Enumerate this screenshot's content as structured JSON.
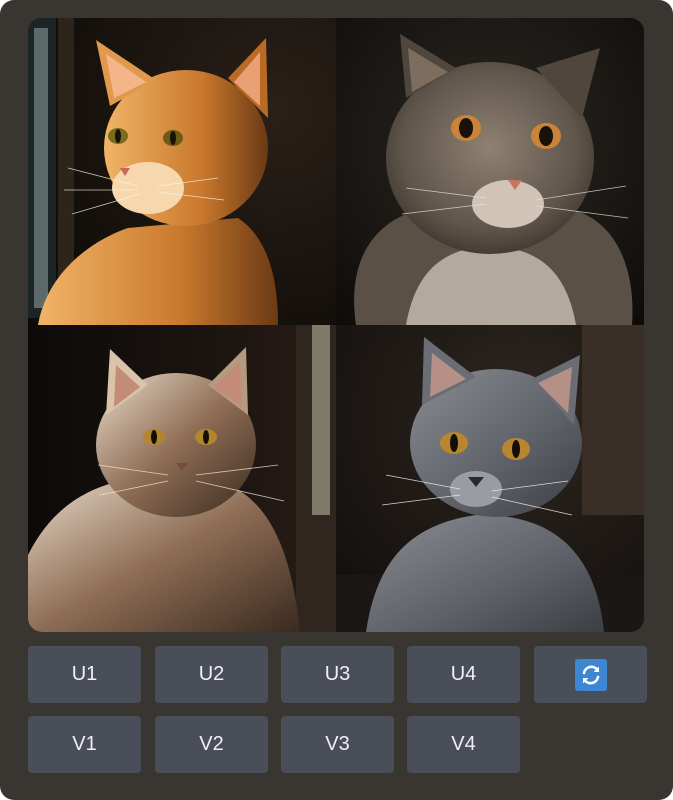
{
  "buttons": {
    "upscale": [
      {
        "label": "U1"
      },
      {
        "label": "U2"
      },
      {
        "label": "U3"
      },
      {
        "label": "U4"
      }
    ],
    "variation": [
      {
        "label": "V1"
      },
      {
        "label": "V2"
      },
      {
        "label": "V3"
      },
      {
        "label": "V4"
      }
    ],
    "reroll": {
      "icon": "refresh-icon",
      "icon_bg": "#3d86d1"
    }
  },
  "grid": {
    "images": [
      {
        "icon": "orange-tabby-cat-photo"
      },
      {
        "icon": "grey-longhair-cat-photo"
      },
      {
        "icon": "maine-coon-cat-photo"
      },
      {
        "icon": "grey-shorthair-cat-photo"
      }
    ]
  },
  "colors": {
    "panel_bg": "#393632",
    "button_bg": "#4a4e59",
    "button_text": "#eef0f3",
    "accent": "#3d86d1"
  }
}
